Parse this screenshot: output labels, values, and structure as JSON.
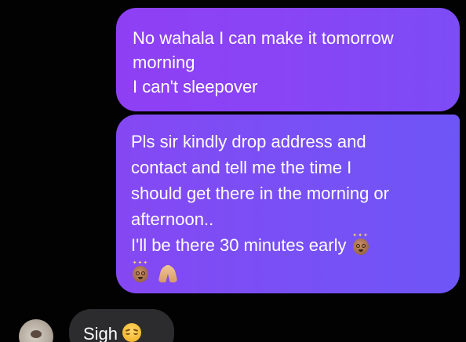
{
  "messages": [
    {
      "direction": "outgoing",
      "lines": [
        "No wahala I can make it tomorrow",
        "morning",
        "I can't sleepover"
      ]
    },
    {
      "direction": "outgoing",
      "lines": [
        "Pls sir kindly drop address and",
        "contact and tell me the time I",
        "should get there in the morning or",
        "afternoon..",
        "I'll be there 30 minutes early"
      ],
      "trailing_emoji": [
        "dizzy-face-icon"
      ],
      "emoji_row": [
        "dizzy-face-icon",
        "folded-hands-icon"
      ]
    },
    {
      "direction": "incoming",
      "text": "Sigh",
      "trailing_emoji": [
        "pensive-face-icon"
      ]
    }
  ],
  "colors": {
    "background": "#020203",
    "outgoing_bubble_start": "#8e3ff4",
    "outgoing_bubble_end": "#6e55f6",
    "incoming_bubble": "#2c2c2e",
    "text": "#ffffff"
  }
}
